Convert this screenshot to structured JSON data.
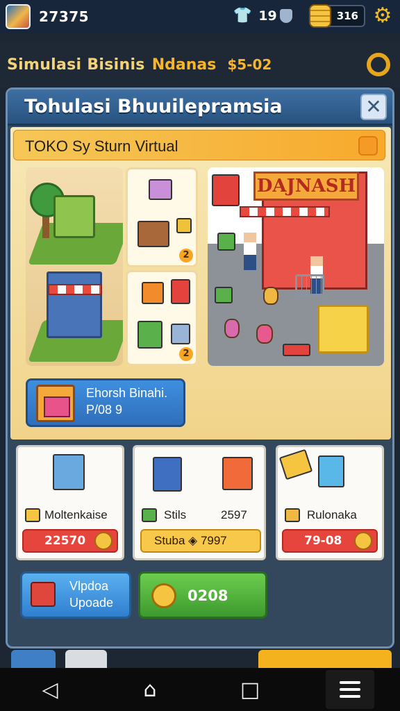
{
  "topbar": {
    "coins": "27375",
    "gems": "19",
    "gold": "316",
    "icons": [
      "avatar-icon",
      "shirt-icon",
      "shield-icon",
      "coin-stack-icon",
      "gear-icon"
    ]
  },
  "business": {
    "title": "Simulasi Bisinis",
    "name": "Ndanas",
    "money": "$5-02"
  },
  "panel": {
    "title": "Tohulasi Bhuuilepramsia",
    "close": "✕",
    "subtitle": "TOKO Sy Sturn Virtual",
    "sign": "DAJNASH",
    "badges": [
      "2",
      "2"
    ],
    "promo": {
      "line1": "Ehorsh Binahi.",
      "line2": "P/08 9"
    }
  },
  "cards": [
    {
      "label": "Moltenkaise",
      "value": "22570"
    },
    {
      "label1": "Stils",
      "label2": "2597",
      "value": "Stuba  ◈  7997"
    },
    {
      "label": "Rulonaka",
      "value": "79-08"
    }
  ],
  "actions": {
    "upgrade_line1": "Vlpdoa",
    "upgrade_line2": "Upoade",
    "collect": "0208"
  },
  "colors": {
    "accent": "#f6b52a",
    "panel": "#33475d",
    "primary": "#2f6fbb",
    "green": "#3d9a2e"
  }
}
